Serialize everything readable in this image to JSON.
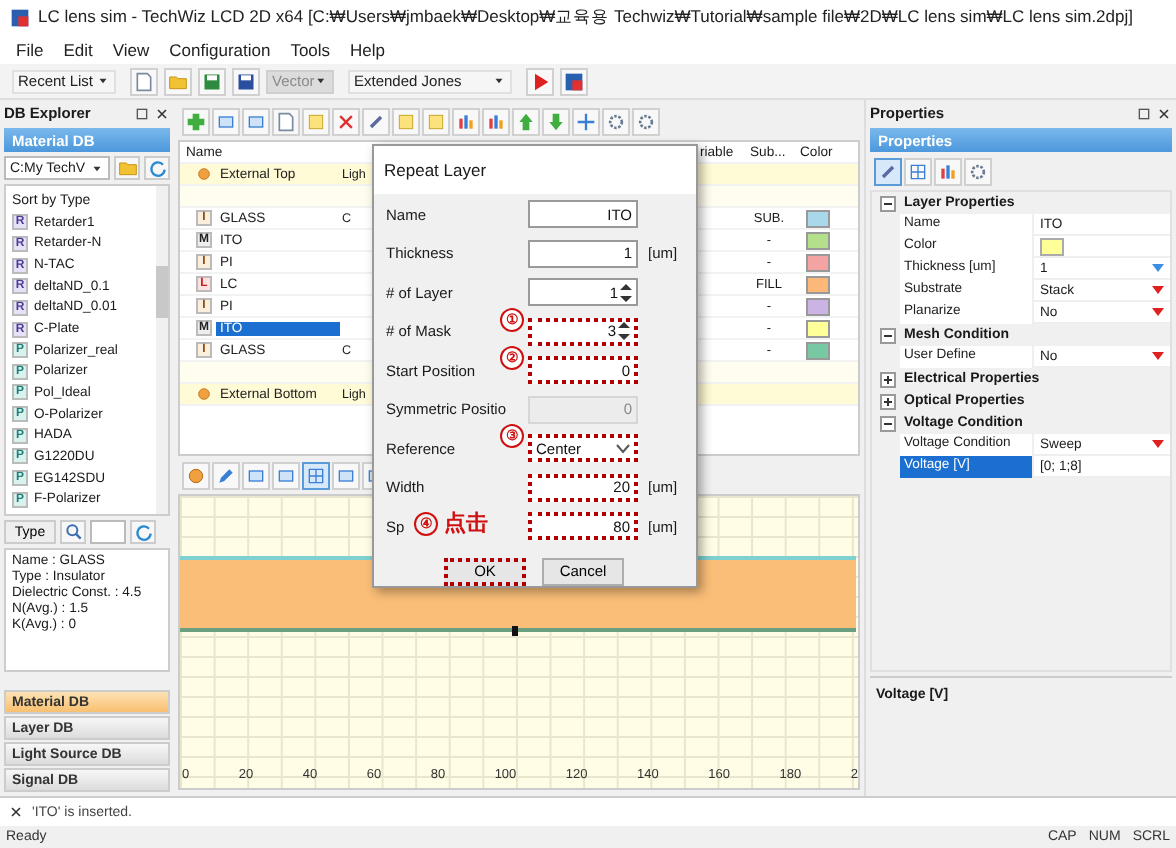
{
  "window": {
    "title": "LC lens sim - TechWiz LCD 2D x64 [C:₩Users₩jmbaek₩Desktop₩교육용 Techwiz₩Tutorial₩sample file₩2D₩LC lens sim₩LC lens sim.2dpj]"
  },
  "menu": [
    "File",
    "Edit",
    "View",
    "Configuration",
    "Tools",
    "Help"
  ],
  "toolbar": {
    "combos": [
      {
        "label": "Recent List",
        "disabled": false
      },
      {
        "label": "Vector",
        "disabled": true
      },
      {
        "label": "Extended Jones",
        "disabled": false
      }
    ]
  },
  "db_explorer": {
    "title": "DB Explorer",
    "header": "Material DB",
    "path": "C:My TechV",
    "sort_label": "Sort by Type",
    "materials": [
      {
        "badge": "R",
        "name": "Retarder1"
      },
      {
        "badge": "R",
        "name": "Retarder-N"
      },
      {
        "badge": "R",
        "name": "N-TAC"
      },
      {
        "badge": "R",
        "name": "deltaND_0.1"
      },
      {
        "badge": "R",
        "name": "deltaND_0.01"
      },
      {
        "badge": "R",
        "name": "C-Plate"
      },
      {
        "badge": "P",
        "name": "Polarizer_real"
      },
      {
        "badge": "P",
        "name": "Polarizer"
      },
      {
        "badge": "P",
        "name": "Pol_Ideal"
      },
      {
        "badge": "P",
        "name": "O-Polarizer"
      },
      {
        "badge": "P",
        "name": "HADA"
      },
      {
        "badge": "P",
        "name": "G1220DU"
      },
      {
        "badge": "P",
        "name": "EG142SDU"
      },
      {
        "badge": "P",
        "name": "F-Polarizer"
      }
    ],
    "filter_button": "Type",
    "info": [
      "Name : GLASS",
      "Type : Insulator",
      "Dielectric Const. : 4.5",
      "N(Avg.) : 1.5",
      "K(Avg.) : 0"
    ],
    "categories": [
      {
        "label": "Material DB",
        "selected": true
      },
      {
        "label": "Layer DB",
        "selected": false
      },
      {
        "label": "Light Source DB",
        "selected": false
      },
      {
        "label": "Signal DB",
        "selected": false
      }
    ]
  },
  "table": {
    "columns": [
      "Name",
      "riable",
      "Sub...",
      "Color"
    ],
    "rows": [
      {
        "kind": "external",
        "name": "External Top",
        "column_2": "Ligh"
      },
      {
        "kind": "blank"
      },
      {
        "kind": "layer",
        "badge": "I",
        "name": "GLASS",
        "column_2": "C",
        "sub": "SUB.",
        "color": "#a8d8ea",
        "selected": false
      },
      {
        "kind": "layer",
        "badge": "M",
        "name": "ITO",
        "sub": "-",
        "color": "#b4e08c",
        "selected": false
      },
      {
        "kind": "layer",
        "badge": "I",
        "name": "PI",
        "sub": "-",
        "color": "#f4a3a3",
        "selected": false
      },
      {
        "kind": "layer",
        "badge": "L",
        "name": "LC",
        "sub": "FILL",
        "color": "#fbb878",
        "selected": false
      },
      {
        "kind": "layer",
        "badge": "I",
        "name": "PI",
        "sub": "-",
        "color": "#ccb3e6",
        "selected": false
      },
      {
        "kind": "layer",
        "badge": "M",
        "name": "ITO",
        "sub": "-",
        "color": "#ffff99",
        "selected": true
      },
      {
        "kind": "layer",
        "badge": "I",
        "name": "GLASS",
        "column_2": "C",
        "sub": "-",
        "color": "#78c8a4",
        "selected": false
      },
      {
        "kind": "blank"
      },
      {
        "kind": "external",
        "name": "External Bottom",
        "column_2": "Ligh"
      }
    ]
  },
  "chart": {
    "tools": [
      {
        "selected": false
      },
      {
        "selected": false
      },
      {
        "selected": false
      },
      {
        "selected": false
      },
      {
        "selected": true
      },
      {
        "selected": false
      },
      {
        "selected": false
      }
    ],
    "x_ticks": [
      "0",
      "20",
      "40",
      "60",
      "80",
      "100",
      "120",
      "140",
      "160",
      "180",
      "2"
    ]
  },
  "dialog": {
    "title": "Repeat Layer",
    "fields": [
      {
        "label": "Name",
        "kind": "text",
        "value": "ITO",
        "disabled": false,
        "highlighted": false
      },
      {
        "label": "Thickness",
        "kind": "text",
        "value": "1",
        "unit": "[um]",
        "disabled": false,
        "highlighted": false
      },
      {
        "label": "# of Layer",
        "kind": "spin",
        "value": "1",
        "disabled": false,
        "highlighted": false
      },
      {
        "label": "# of Mask",
        "kind": "spin",
        "value": "3",
        "disabled": false,
        "highlighted": true,
        "marker": "①"
      },
      {
        "label": "Start Position",
        "kind": "text",
        "value": "0",
        "disabled": false,
        "highlighted": true,
        "marker": "②"
      },
      {
        "label": "Symmetric Positio",
        "kind": "text",
        "value": "0",
        "disabled": true,
        "highlighted": false
      },
      {
        "label": "Reference",
        "kind": "select",
        "value": "Center",
        "disabled": false,
        "highlighted": true,
        "marker": "③"
      },
      {
        "label": "Width",
        "kind": "text",
        "value": "20",
        "unit": "[um]",
        "disabled": false,
        "highlighted": true
      },
      {
        "label": "Sp",
        "kind": "text",
        "value": "80",
        "unit": "[um]",
        "disabled": false,
        "highlighted": true
      }
    ],
    "buttons": [
      {
        "label": "OK",
        "highlighted": true
      },
      {
        "label": "Cancel",
        "highlighted": false
      }
    ],
    "callout": {
      "marker": "④",
      "text": "点击"
    }
  },
  "properties": {
    "title": "Properties",
    "header": "Properties",
    "tools": [
      {
        "selected": true
      },
      {
        "selected": false
      },
      {
        "selected": false
      },
      {
        "selected": false
      }
    ],
    "groups": [
      {
        "label": "Layer Properties",
        "expanded": true,
        "rows": [
          {
            "name": "Name",
            "kind": "text",
            "value": "ITO",
            "selected": false
          },
          {
            "name": "Color",
            "kind": "color",
            "color": "#ffff99",
            "selected": false
          },
          {
            "name": "Thickness [um]",
            "kind": "spin",
            "value": "1",
            "selected": false
          },
          {
            "name": "Substrate",
            "kind": "dropdown",
            "value": "Stack",
            "selected": false
          },
          {
            "name": "Planarize",
            "kind": "dropdown",
            "value": "No",
            "selected": false
          }
        ]
      },
      {
        "label": "Mesh Condition",
        "expanded": true,
        "rows": [
          {
            "name": "User Define",
            "kind": "dropdown",
            "value": "No",
            "selected": false
          }
        ]
      },
      {
        "label": "Electrical Properties",
        "expanded": false
      },
      {
        "label": "Optical Properties",
        "expanded": false
      },
      {
        "label": "Voltage Condition",
        "expanded": true,
        "rows": [
          {
            "name": "Voltage Condition",
            "kind": "dropdown",
            "value": "Sweep",
            "selected": false
          },
          {
            "name": "Voltage [V]",
            "kind": "text",
            "value": "[0; 1;8]",
            "selected": true
          }
        ]
      }
    ],
    "description": "Voltage [V]"
  },
  "log": [
    "'ITO' is inserted."
  ],
  "status_bar": {
    "message": "Ready",
    "indicators": [
      "CAP",
      "NUM",
      "SCRL"
    ]
  }
}
